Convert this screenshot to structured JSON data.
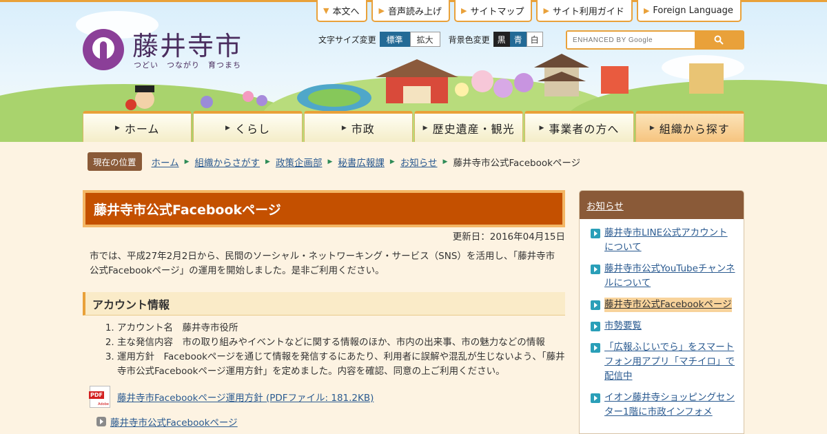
{
  "site": {
    "name": "藤井寺市",
    "tagline": "つどい　つながり　育つまち"
  },
  "utility_nav": [
    {
      "label": "本文へ"
    },
    {
      "label": "音声読み上げ"
    },
    {
      "label": "サイトマップ"
    },
    {
      "label": "サイト利用ガイド"
    },
    {
      "label": "Foreign Language"
    }
  ],
  "text_size": {
    "label": "文字サイズ変更",
    "options": [
      "標準",
      "拡大"
    ],
    "selected": "標準"
  },
  "bg_color": {
    "label": "背景色変更",
    "options": [
      "黒",
      "青",
      "白"
    ]
  },
  "search": {
    "placeholder": "ENHANCED BY Google",
    "button_icon": "search-icon"
  },
  "global_nav": [
    {
      "label": "ホーム"
    },
    {
      "label": "くらし"
    },
    {
      "label": "市政"
    },
    {
      "label": "歴史遺産・観光"
    },
    {
      "label": "事業者の方へ"
    },
    {
      "label": "組織から探す"
    }
  ],
  "breadcrumb": {
    "label": "現在の位置",
    "items": [
      "ホーム",
      "組織からさがす",
      "政策企画部",
      "秘書広報課",
      "お知らせ"
    ],
    "current": "藤井寺市公式Facebookページ"
  },
  "page": {
    "title": "藤井寺市公式Facebookページ",
    "updated": "更新日：2016年04月15日",
    "intro": "市では、平成27年2月2日から、民間のソーシャル・ネットワーキング・サービス（SNS）を活用し、「藤井寺市公式Facebookページ」の運用を開始しました。是非ご利用ください。",
    "section_title": "アカウント情報",
    "list": [
      "アカウント名　藤井寺市役所",
      "主な発信内容　市の取り組みやイベントなどに関する情報のほか、市内の出来事、市の魅力などの情報",
      "運用方針　Facebookページを通じて情報を発信するにあたり、利用者に誤解や混乱が生じないよう、「藤井寺市公式Facebookページ運用方針」を定めました。内容を確認、同意の上ご利用ください。"
    ],
    "pdf_icon_label": "PDF",
    "pdf_link": "藤井寺市Facebookページ運用方針 (PDFファイル: 181.2KB)",
    "fb_link": "藤井寺市公式Facebookページ"
  },
  "sidebar": {
    "title": "お知らせ",
    "items": [
      {
        "label": "藤井寺市LINE公式アカウントについて"
      },
      {
        "label": "藤井寺市公式YouTubeチャンネルについて"
      },
      {
        "label": "藤井寺市公式Facebookページ"
      },
      {
        "label": "市勢要覧"
      },
      {
        "label": "「広報ふじいでら」をスマートフォン用アプリ「マチイロ」で配信中"
      },
      {
        "label": "イオン藤井寺ショッピングセンター1階に市政インフォメ"
      }
    ]
  },
  "colors": {
    "accent_orange": "#e9a13a",
    "title_bg": "#c45000",
    "brown": "#8a5a38",
    "link": "#2a5a90",
    "logo_purple": "#8b3f98"
  }
}
